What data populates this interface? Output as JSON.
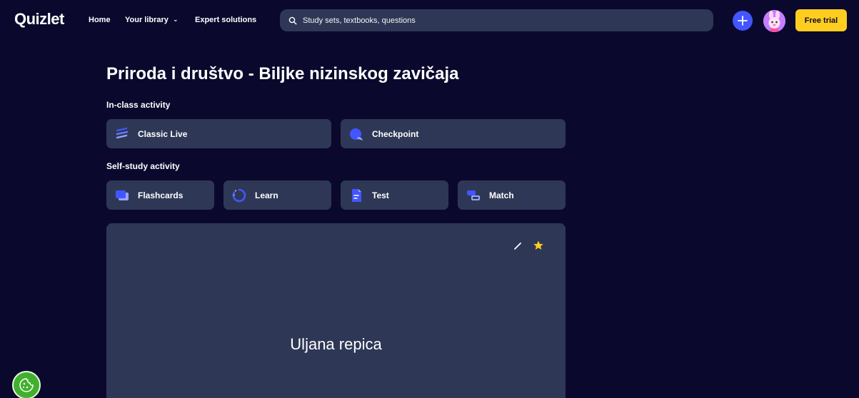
{
  "header": {
    "logo": "Quizlet",
    "nav": {
      "home": "Home",
      "library": "Your library",
      "expert": "Expert solutions"
    },
    "search": {
      "placeholder": "Study sets, textbooks, questions"
    },
    "free_trial": "Free trial"
  },
  "set": {
    "title": "Priroda i društvo - Biljke nizinskog zavičaja"
  },
  "in_class": {
    "label": "In-class activity",
    "items": [
      {
        "label": "Classic Live",
        "icon": "classic-live-icon"
      },
      {
        "label": "Checkpoint",
        "icon": "checkpoint-icon"
      }
    ]
  },
  "self_study": {
    "label": "Self-study activity",
    "items": [
      {
        "label": "Flashcards",
        "icon": "flashcards-icon"
      },
      {
        "label": "Learn",
        "icon": "learn-icon"
      },
      {
        "label": "Test",
        "icon": "test-icon"
      },
      {
        "label": "Match",
        "icon": "match-icon"
      }
    ]
  },
  "flashcard": {
    "term": "Uljana repica"
  },
  "colors": {
    "background": "#0a092d",
    "surface": "#2e3856",
    "accent": "#4255ff",
    "trial": "#ffcd1f",
    "star": "#ffcd1f"
  }
}
